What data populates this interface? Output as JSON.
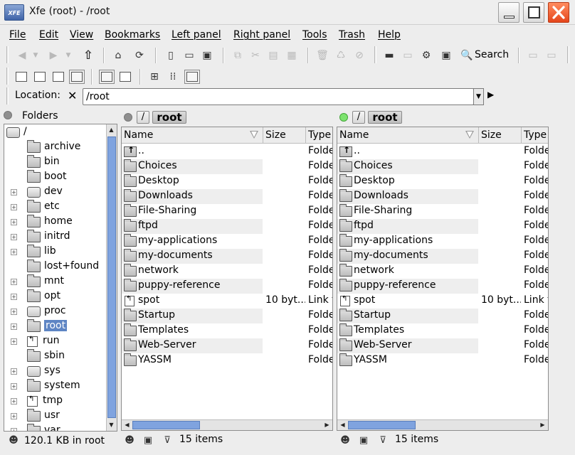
{
  "window": {
    "title": "Xfe (root) - /root",
    "icon_text": "XFE"
  },
  "menus": [
    "File",
    "Edit",
    "View",
    "Bookmarks",
    "Left panel",
    "Right panel",
    "Tools",
    "Trash",
    "Help"
  ],
  "toolbar": {
    "search_label": "Search"
  },
  "location": {
    "label": "Location:",
    "value": "/root"
  },
  "tree": {
    "header": "Folders",
    "root": "/",
    "items": [
      {
        "label": "archive",
        "icon": "folder",
        "expandable": false
      },
      {
        "label": "bin",
        "icon": "folder",
        "expandable": false
      },
      {
        "label": "boot",
        "icon": "folder",
        "expandable": false
      },
      {
        "label": "dev",
        "icon": "drive",
        "expandable": true
      },
      {
        "label": "etc",
        "icon": "folder",
        "expandable": true
      },
      {
        "label": "home",
        "icon": "folder",
        "expandable": true
      },
      {
        "label": "initrd",
        "icon": "folder",
        "expandable": true
      },
      {
        "label": "lib",
        "icon": "folder",
        "expandable": true
      },
      {
        "label": "lost+found",
        "icon": "folder",
        "expandable": false
      },
      {
        "label": "mnt",
        "icon": "folder",
        "expandable": true
      },
      {
        "label": "opt",
        "icon": "folder",
        "expandable": true
      },
      {
        "label": "proc",
        "icon": "drive",
        "expandable": true
      },
      {
        "label": "root",
        "icon": "folder",
        "expandable": true,
        "selected": true
      },
      {
        "label": "run",
        "icon": "link",
        "expandable": true
      },
      {
        "label": "sbin",
        "icon": "folder",
        "expandable": false
      },
      {
        "label": "sys",
        "icon": "drive",
        "expandable": true
      },
      {
        "label": "system",
        "icon": "folder",
        "expandable": true
      },
      {
        "label": "tmp",
        "icon": "link",
        "expandable": true
      },
      {
        "label": "usr",
        "icon": "folder",
        "expandable": true
      },
      {
        "label": "var",
        "icon": "folder",
        "expandable": true
      }
    ]
  },
  "panels": [
    {
      "crumb_root": "/",
      "crumb_dir": "root",
      "active": false,
      "columns": {
        "name": "Name",
        "size": "Size",
        "type": "Type"
      },
      "status": "15 items",
      "files": [
        {
          "name": "..",
          "size": "",
          "type": "Folde",
          "icon": "up"
        },
        {
          "name": "Choices",
          "size": "",
          "type": "Folde",
          "icon": "folder"
        },
        {
          "name": "Desktop",
          "size": "",
          "type": "Folde",
          "icon": "folder"
        },
        {
          "name": "Downloads",
          "size": "",
          "type": "Folde",
          "icon": "folder"
        },
        {
          "name": "File-Sharing",
          "size": "",
          "type": "Folde",
          "icon": "folder"
        },
        {
          "name": "ftpd",
          "size": "",
          "type": "Folde",
          "icon": "folder"
        },
        {
          "name": "my-applications",
          "size": "",
          "type": "Folde",
          "icon": "folder"
        },
        {
          "name": "my-documents",
          "size": "",
          "type": "Folde",
          "icon": "folder"
        },
        {
          "name": "network",
          "size": "",
          "type": "Folde",
          "icon": "folder"
        },
        {
          "name": "puppy-reference",
          "size": "",
          "type": "Folde",
          "icon": "folder"
        },
        {
          "name": "spot",
          "size": "10 byt...",
          "type": "Link t",
          "icon": "link"
        },
        {
          "name": "Startup",
          "size": "",
          "type": "Folde",
          "icon": "folder"
        },
        {
          "name": "Templates",
          "size": "",
          "type": "Folde",
          "icon": "folder"
        },
        {
          "name": "Web-Server",
          "size": "",
          "type": "Folde",
          "icon": "folder"
        },
        {
          "name": "YASSM",
          "size": "",
          "type": "Folde",
          "icon": "folder"
        }
      ]
    },
    {
      "crumb_root": "/",
      "crumb_dir": "root",
      "active": true,
      "columns": {
        "name": "Name",
        "size": "Size",
        "type": "Type"
      },
      "status": "15 items",
      "files": [
        {
          "name": "..",
          "size": "",
          "type": "Folder",
          "icon": "up"
        },
        {
          "name": "Choices",
          "size": "",
          "type": "Folder",
          "icon": "folder"
        },
        {
          "name": "Desktop",
          "size": "",
          "type": "Folder",
          "icon": "folder"
        },
        {
          "name": "Downloads",
          "size": "",
          "type": "Folder",
          "icon": "folder"
        },
        {
          "name": "File-Sharing",
          "size": "",
          "type": "Folder",
          "icon": "folder"
        },
        {
          "name": "ftpd",
          "size": "",
          "type": "Folder",
          "icon": "folder"
        },
        {
          "name": "my-applications",
          "size": "",
          "type": "Folder",
          "icon": "folder"
        },
        {
          "name": "my-documents",
          "size": "",
          "type": "Folder",
          "icon": "folder"
        },
        {
          "name": "network",
          "size": "",
          "type": "Folder",
          "icon": "folder"
        },
        {
          "name": "puppy-reference",
          "size": "",
          "type": "Folder",
          "icon": "folder"
        },
        {
          "name": "spot",
          "size": "10 byt...",
          "type": "Link to Fo",
          "icon": "link"
        },
        {
          "name": "Startup",
          "size": "",
          "type": "Folder",
          "icon": "folder"
        },
        {
          "name": "Templates",
          "size": "",
          "type": "Folder",
          "icon": "folder"
        },
        {
          "name": "Web-Server",
          "size": "",
          "type": "Folder",
          "icon": "folder"
        },
        {
          "name": "YASSM",
          "size": "",
          "type": "Folder",
          "icon": "folder"
        }
      ]
    }
  ],
  "statusbar": {
    "tree_text": "120.1 KB in root"
  },
  "colors": {
    "selection": "#5e85c4",
    "scroll_thumb": "#7fa3df",
    "close_button": "#e5461c",
    "active_led": "#7de36f"
  }
}
